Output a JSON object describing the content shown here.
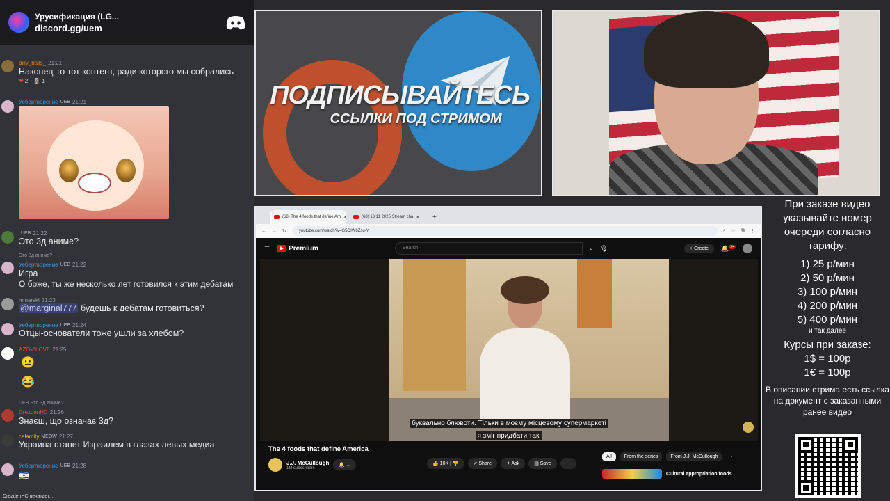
{
  "discord": {
    "server_title": "Урусификация (LG...",
    "invite": "discord.gg/uem",
    "typing": "DrezdenHC печатает..."
  },
  "messages": [
    {
      "user": "billy_balls_",
      "time": "21:21",
      "color": "#e67e22",
      "text": "Наконец-то тот контент, ради которого мы собрались",
      "reactions": [
        {
          "emoji": "❤",
          "count": "2"
        },
        {
          "emoji": "🗿",
          "count": "1"
        }
      ]
    },
    {
      "user": "Уебертворение",
      "badge": "UEB",
      "time": "21:21",
      "color": "#3498db",
      "text": ""
    },
    {
      "user": "",
      "badge": "UEB",
      "time": "21:22",
      "color": "#1abc9c",
      "text": "Это 3д аниме?"
    },
    {
      "user": "Уебертворение",
      "badge": "UEB",
      "time": "21:22",
      "color": "#3498db",
      "reply": "Это 3д аниме?",
      "text": "Игра",
      "text2": "О боже, ты же несколько лет готовился к этим дебатам"
    },
    {
      "user": "minarski",
      "time": "21:23",
      "color": "#95a5a6",
      "mention": "@marginal777",
      "text": " будешь к дебатам готовиться?"
    },
    {
      "user": "Уебертворение",
      "badge": "UEB",
      "time": "21:24",
      "color": "#3498db",
      "text": "Отцы-основатели тоже ушли за хлебом?"
    },
    {
      "user": "AZOV!LOVE",
      "time": "21:25",
      "color": "#e74c3c",
      "emoji1": "😐",
      "emoji2": "😂"
    },
    {
      "user": "DrezdenHC",
      "time": "21:26",
      "color": "#e74c3c",
      "reply": "Это 3д аниме?",
      "reply_badge": "UEB",
      "text": "Знаєш, що означає 3д?"
    },
    {
      "user": "calamity",
      "badge": "MEOW",
      "time": "21:27",
      "color": "#f1c40f",
      "text": "Украина станет Израилем в глазах левых медиа"
    },
    {
      "user": "Уебертворение",
      "badge": "UEB",
      "time": "21:28",
      "color": "#3498db",
      "flag": "🇮🇱"
    }
  ],
  "promo": {
    "title": "ПОДПИСЫВАЙТЕСЬ",
    "subtitle": "ССЫЛКИ ПОД СТРИМОМ"
  },
  "browser": {
    "tab1": "(68) The 4 foods that define Am",
    "tab2": "(68) 13 11 2025 Stream cha",
    "url": "youtube.com/watch?v=G5OIW6Zsu-Y",
    "yt_brand": "Premium",
    "search_placeholder": "Search",
    "create": "Create",
    "notif_count": "9+",
    "subtitle_line1": "буквально блювоти. Тільки в моєму місцевому супермаркеті",
    "subtitle_line2": "я зміг придбати такі",
    "video_title": "The 4 foods that define America",
    "channel": "J.J. McCullough",
    "subscribers": "1M subscribers",
    "likes": "10K",
    "share": "Share",
    "ask": "Ask",
    "save": "Save",
    "chips": [
      "All",
      "From the series",
      "From J.J. McCullough"
    ],
    "rec_title": "Cultural appropriation foods"
  },
  "info": {
    "heading": "При заказе видео указывайте номер очереди согласно тарифу:",
    "rates": [
      "1) 25 р/мин",
      "2) 50 р/мин",
      "3) 100 р/мин",
      "4) 200 р/мин",
      "5) 400 р/мин"
    ],
    "etc": "и так далее",
    "course_heading": "Курсы при заказе:",
    "usd": "1$ = 100р",
    "eur": "1€ = 100р",
    "desc": "В описании стрима есть ссылка на документ с заказанными ранее видео"
  }
}
